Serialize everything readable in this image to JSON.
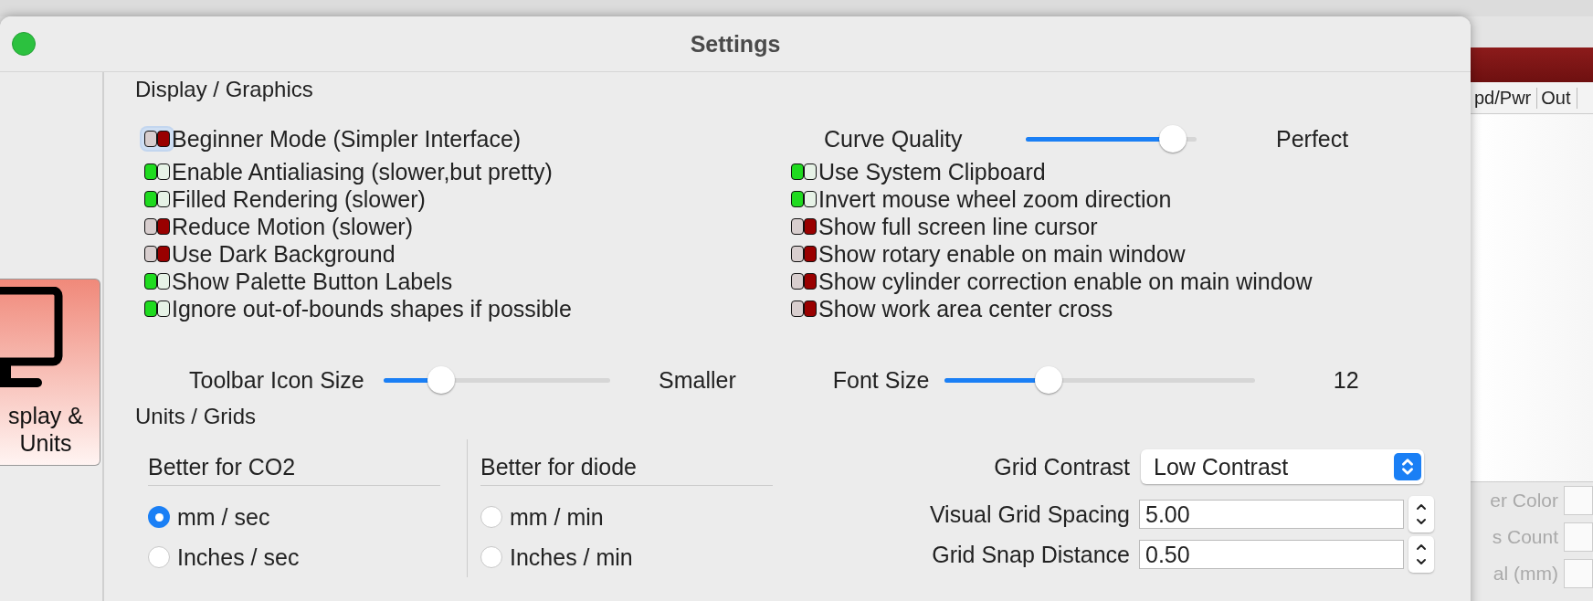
{
  "background_panel": {
    "columns": [
      "pd/Pwr",
      "Out"
    ],
    "fields": [
      "er Color",
      "s Count",
      "al (mm)"
    ]
  },
  "window": {
    "title": "Settings"
  },
  "sidebar": {
    "items": [
      {
        "label": "splay & Units",
        "selected": true
      }
    ]
  },
  "display_graphics": {
    "heading": "Display / Graphics",
    "left_options": [
      {
        "label": "Beginner Mode (Simpler Interface)",
        "on": false,
        "focused": true
      },
      {
        "label": "Enable Antialiasing (slower,but pretty)",
        "on": true,
        "focused": false
      },
      {
        "label": "Filled Rendering (slower)",
        "on": true,
        "focused": false
      },
      {
        "label": "Reduce Motion (slower)",
        "on": false,
        "focused": false
      },
      {
        "label": "Use Dark Background",
        "on": false,
        "focused": false
      },
      {
        "label": "Show Palette Button Labels",
        "on": true,
        "focused": false
      },
      {
        "label": "Ignore out-of-bounds shapes if possible",
        "on": true,
        "focused": false
      }
    ],
    "curve_quality": {
      "label": "Curve Quality",
      "level": 0.93,
      "reading": "Perfect"
    },
    "right_options": [
      {
        "label": "Use System Clipboard",
        "on": true
      },
      {
        "label": "Invert mouse wheel zoom direction",
        "on": true
      },
      {
        "label": "Show full screen line cursor",
        "on": false
      },
      {
        "label": "Show rotary enable on main window",
        "on": false
      },
      {
        "label": "Show cylinder correction enable on main window",
        "on": false
      },
      {
        "label": "Show work area center cross",
        "on": false
      }
    ],
    "toolbar_icon_size": {
      "label": "Toolbar Icon Size",
      "level": 0.22,
      "reading": "Smaller"
    },
    "font_size": {
      "label": "Font Size",
      "level": 0.32,
      "reading": "12"
    }
  },
  "units_grids": {
    "heading": "Units / Grids",
    "groups": [
      {
        "title": "Better for CO2",
        "options": [
          {
            "label": "mm / sec",
            "selected": true
          },
          {
            "label": "Inches / sec",
            "selected": false
          }
        ]
      },
      {
        "title": "Better for diode",
        "options": [
          {
            "label": "mm / min",
            "selected": false
          },
          {
            "label": "Inches / min",
            "selected": false
          }
        ]
      }
    ],
    "grid_contrast": {
      "label": "Grid Contrast",
      "value": "Low Contrast"
    },
    "fields": [
      {
        "label": "Visual Grid Spacing",
        "value": "5.00"
      },
      {
        "label": "Grid Snap Distance",
        "value": "0.50"
      }
    ]
  }
}
